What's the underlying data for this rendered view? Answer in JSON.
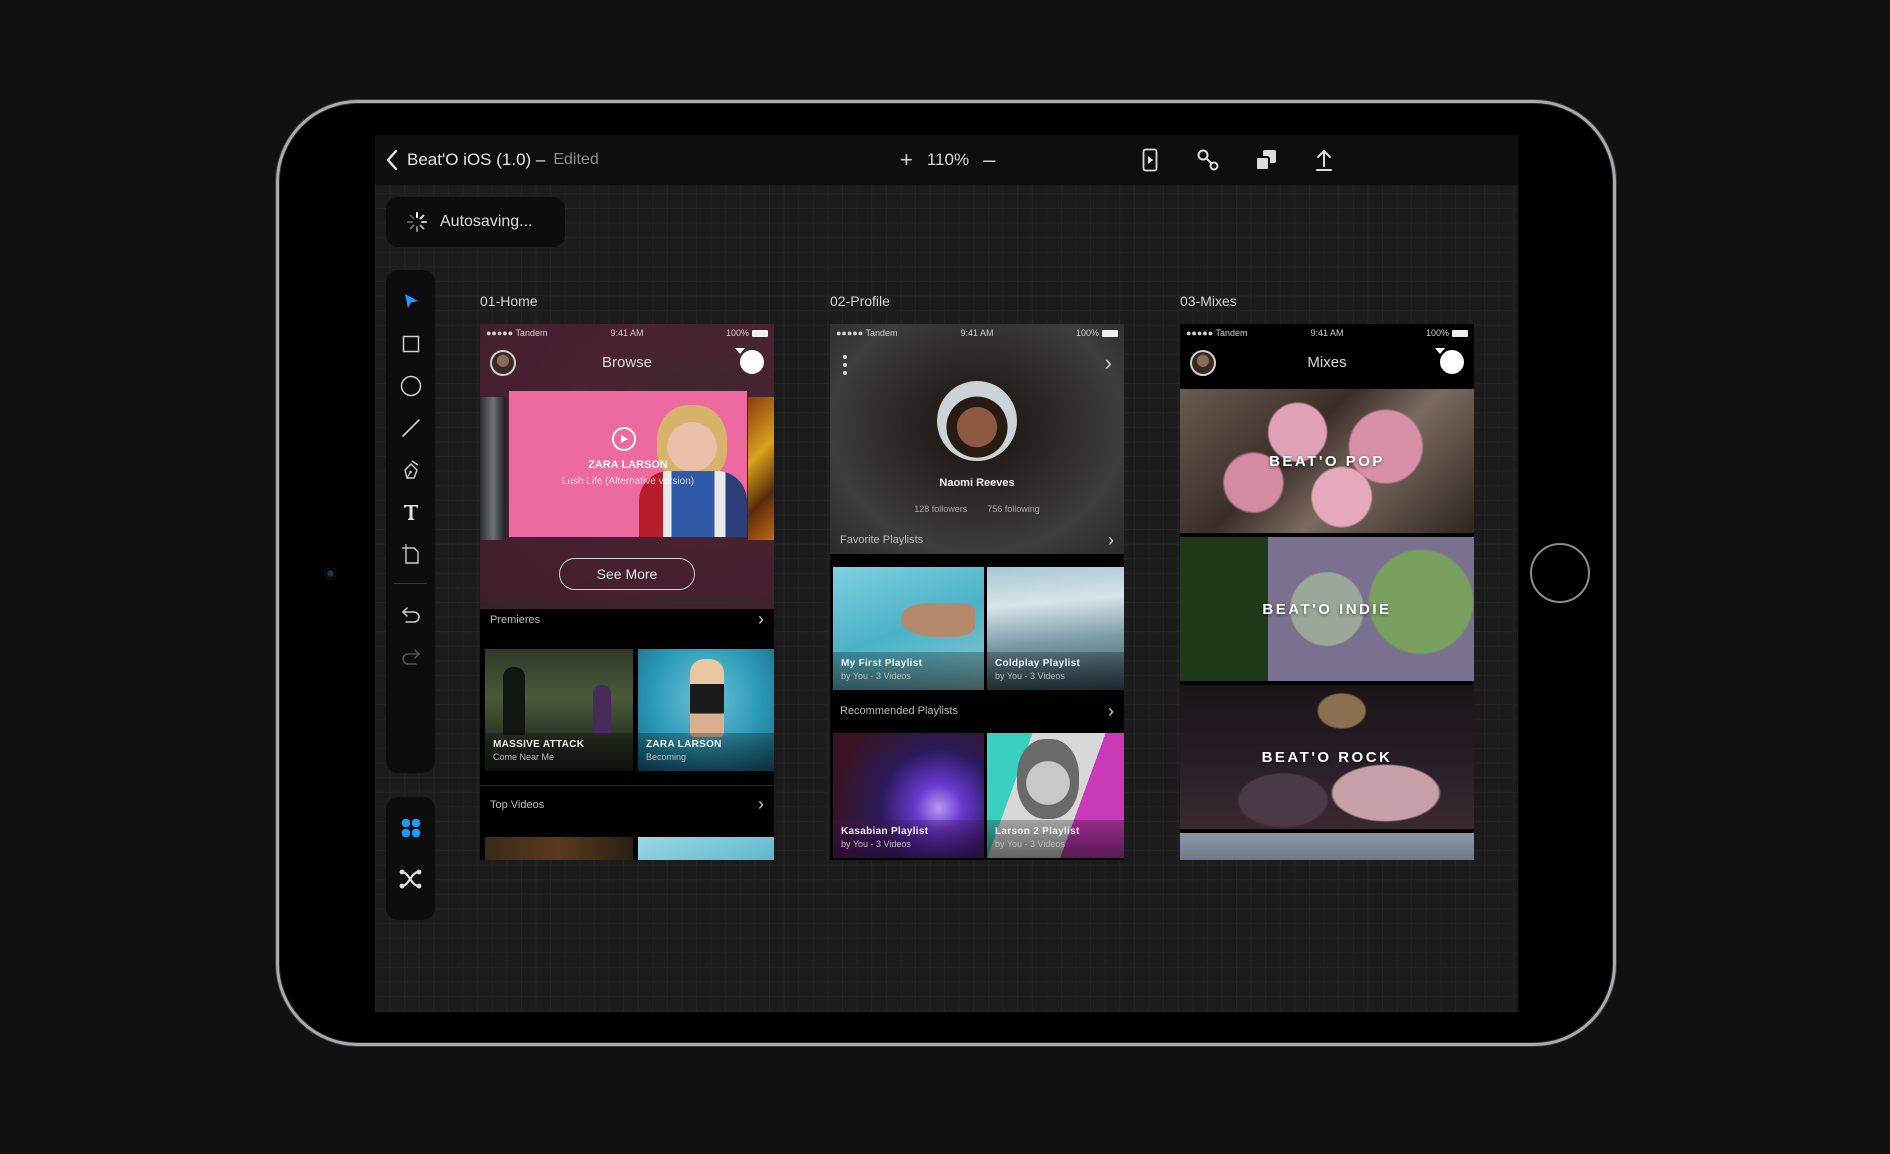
{
  "app": {
    "title": "Beat'O iOS (1.0) –",
    "title_status": "Edited",
    "zoom_level": "110%",
    "zoom_in_label": "+",
    "zoom_out_label": "–",
    "autosave_text": "Autosaving...",
    "toolbar_right": [
      {
        "icon": "preview-icon",
        "label": "Preview"
      },
      {
        "icon": "link-icon",
        "label": "Prototype links"
      },
      {
        "icon": "layers-icon",
        "label": "Arrange"
      },
      {
        "icon": "share-icon",
        "label": "Share/Export"
      }
    ],
    "tools": [
      {
        "icon": "select-arrow-icon",
        "label": "Select",
        "active": true
      },
      {
        "icon": "rectangle-icon",
        "label": "Rectangle"
      },
      {
        "icon": "ellipse-icon",
        "label": "Ellipse"
      },
      {
        "icon": "line-icon",
        "label": "Line"
      },
      {
        "icon": "pen-icon",
        "label": "Pen"
      },
      {
        "icon": "text-icon",
        "label": "Text"
      },
      {
        "icon": "artboard-icon",
        "label": "Artboard"
      },
      {
        "icon": "undo-icon",
        "label": "Undo"
      },
      {
        "icon": "redo-icon",
        "label": "Redo",
        "disabled": true
      }
    ],
    "modes": [
      {
        "icon": "design-mode-icon",
        "label": "Design",
        "active": true
      },
      {
        "icon": "prototype-mode-icon",
        "label": "Prototype"
      }
    ],
    "accent_color": "#1a9bff"
  },
  "status_bar": {
    "carrier": "●●●●● Tandem",
    "time": "9:41 AM",
    "battery": "100%"
  },
  "artboards": {
    "home": {
      "label": "01-Home",
      "nav_title": "Browse",
      "hero": {
        "artist": "ZARA LARSON",
        "song": "Lush Life (Alternative version)"
      },
      "see_more": "See More",
      "premieres_title": "Premieres",
      "premieres": [
        {
          "title": "MASSIVE ATTACK",
          "subtitle": "Come Near Me"
        },
        {
          "title": "ZARA LARSON",
          "subtitle": "Becoming"
        }
      ],
      "top_videos_title": "Top Videos"
    },
    "profile": {
      "label": "02-Profile",
      "name": "Naomi Reeves",
      "followers": "128 followers",
      "following": "756 following",
      "favorites_title": "Favorite Playlists",
      "favorites": [
        {
          "title": "My First Playlist",
          "subtitle": "by You - 3 Videos"
        },
        {
          "title": "Coldplay Playlist",
          "subtitle": "by You - 3 Videos"
        }
      ],
      "recommended_title": "Recommended Playlists",
      "recommended": [
        {
          "title": "Kasabian Playlist",
          "subtitle": "by You - 3 Videos"
        },
        {
          "title": "Larson 2 Playlist",
          "subtitle": "by You - 3 Videos"
        }
      ]
    },
    "mixes": {
      "label": "03-Mixes",
      "nav_title": "Mixes",
      "items": [
        {
          "title": "BEAT'O POP"
        },
        {
          "title": "BEAT'O INDIE"
        },
        {
          "title": "BEAT'O ROCK"
        }
      ]
    }
  }
}
